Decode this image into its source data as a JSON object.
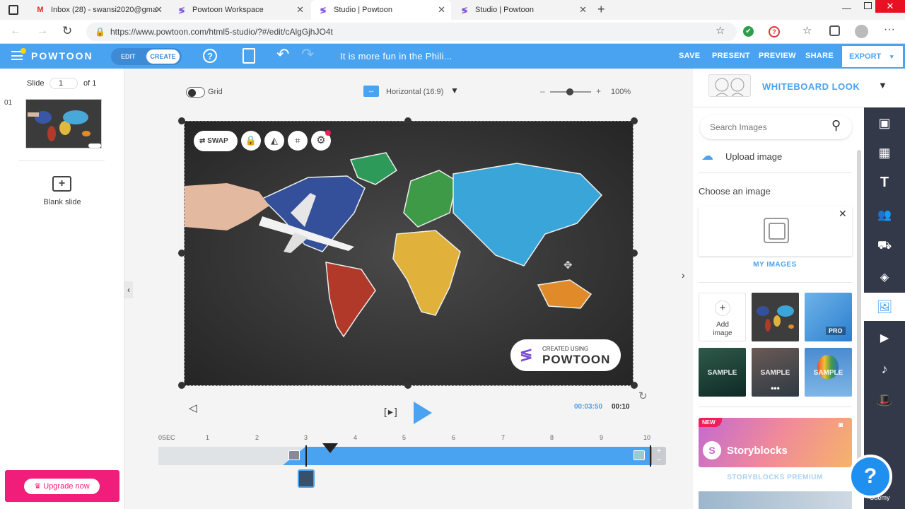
{
  "browser": {
    "tabs": [
      {
        "title": "Inbox (28) - swansi2020@gmail.c",
        "icon": "gmail-icon"
      },
      {
        "title": "Powtoon Workspace",
        "icon": "powtoon-icon"
      },
      {
        "title": "Studio | Powtoon",
        "icon": "powtoon-icon"
      },
      {
        "title": "Studio | Powtoon",
        "icon": "powtoon-icon"
      }
    ],
    "url": "https://www.powtoon.com/html5-studio/?#/edit/cAlgGjhJO4t"
  },
  "toolbar": {
    "logo": "POWTOON",
    "mode_edit": "EDIT",
    "mode_create": "CREATE",
    "title": "It is more fun in the Phili...",
    "save": "SAVE",
    "present": "PRESENT",
    "preview": "PREVIEW",
    "share": "SHARE",
    "export": "EXPORT",
    "accent": "#4aa3f0"
  },
  "slides": {
    "label": "Slide",
    "current": "1",
    "of": "of 1",
    "items": [
      {
        "number": "01"
      }
    ],
    "blank_slide": "Blank slide",
    "upgrade": "Upgrade now"
  },
  "canvas": {
    "grid_label": "Grid",
    "orientation": "Horizontal (16:9)",
    "zoom": "100%",
    "swap_label": "SWAP",
    "watermark_small": "CREATED USING",
    "watermark_big": "POWTOON"
  },
  "timeline": {
    "current_time": "00:03:50",
    "total_time": "00:10",
    "ticks": [
      "0SEC",
      "1",
      "2",
      "3",
      "4",
      "5",
      "6",
      "7",
      "8",
      "9",
      "10"
    ]
  },
  "rightpanel": {
    "look_title": "WHITEBOARD LOOK",
    "search_placeholder": "Search Images",
    "upload": "Upload image",
    "choose": "Choose an image",
    "my_images": "MY IMAGES",
    "add_image": "Add image",
    "pro_badge": "PRO",
    "sample_label": "SAMPLE",
    "new_badge": "NEW",
    "storyblocks": "Storyblocks",
    "storyblocks_premium": "STORYBLOCKS PREMIUM",
    "udemy": "Udemy",
    "help": "?"
  }
}
